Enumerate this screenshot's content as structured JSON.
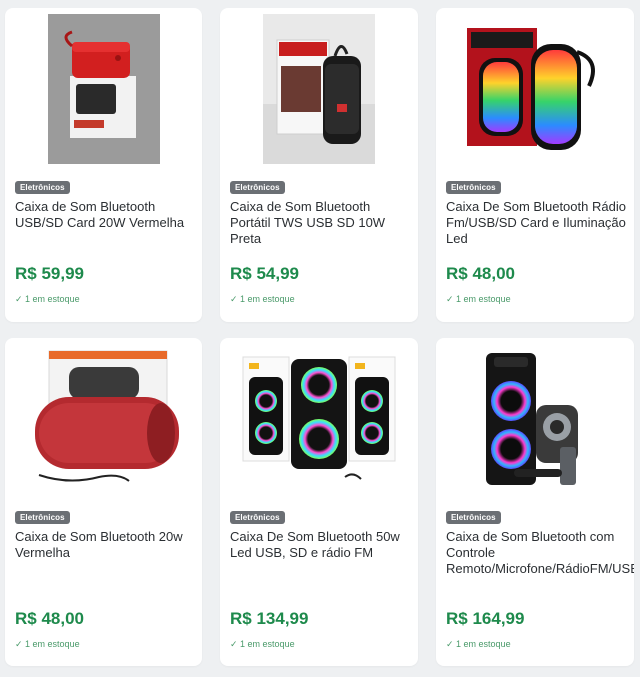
{
  "products": [
    {
      "category": "Eletrônicos",
      "title": "Caixa de Som Bluetooth USB/SD Card 20W Vermelha",
      "price": "R$ 59,99",
      "stock": "✓ 1 em estoque",
      "image_icon": "red-speaker-box-image"
    },
    {
      "category": "Eletrônicos",
      "title": "Caixa de Som Bluetooth Portátil TWS USB SD 10W Preta",
      "price": "R$ 54,99",
      "stock": "✓ 1 em estoque",
      "image_icon": "black-tws-speaker-image"
    },
    {
      "category": "Eletrônicos",
      "title": "Caixa De Som Bluetooth Rádio Fm/USB/SD Card e Iluminação Led",
      "price": "R$ 48,00",
      "stock": "✓ 1 em estoque",
      "image_icon": "led-speaker-image"
    },
    {
      "category": "Eletrônicos",
      "title": "Caixa de Som Bluetooth 20w Vermelha",
      "price": "R$ 48,00",
      "stock": "✓ 1 em estoque",
      "image_icon": "red-cylinder-speaker-image"
    },
    {
      "category": "Eletrônicos",
      "title": "Caixa De Som Bluetooth 50w Led USB, SD e rádio FM",
      "price": "R$ 134,99",
      "stock": "✓ 1 em estoque",
      "image_icon": "50w-led-speaker-image"
    },
    {
      "category": "Eletrônicos",
      "title": "Caixa de Som Bluetooth com Controle Remoto/Microfone/RádioFM/USB/SD",
      "price": "R$ 164,99",
      "stock": "✓ 1 em estoque",
      "image_icon": "party-speaker-remote-mic-image"
    }
  ],
  "colors": {
    "price": "#1e8a4c",
    "badge": "#6b6f74",
    "stock": "#4a9a6a",
    "background": "#eef0f2"
  }
}
